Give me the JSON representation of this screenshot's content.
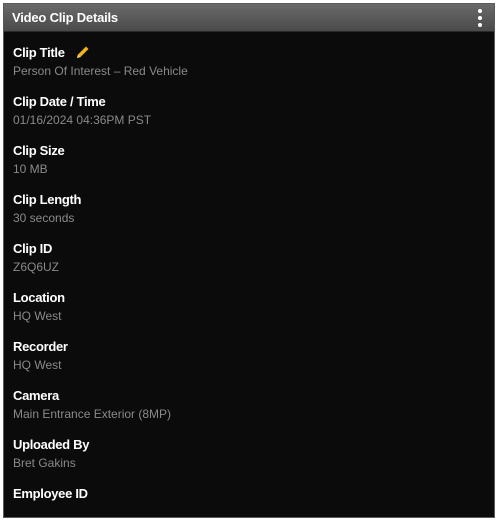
{
  "panel": {
    "title": "Video Clip Details",
    "accent_color": "#f2b21b"
  },
  "fields": [
    {
      "label": "Clip Title",
      "value": "Person Of Interest – Red Vehicle"
    },
    {
      "label": "Clip Date / Time",
      "value": "01/16/2024 04:36PM PST"
    },
    {
      "label": "Clip Size",
      "value": "10 MB"
    },
    {
      "label": "Clip Length",
      "value": "30 seconds"
    },
    {
      "label": "Clip ID",
      "value": "Z6Q6UZ"
    },
    {
      "label": "Location",
      "value": "HQ West"
    },
    {
      "label": "Recorder",
      "value": "HQ West"
    },
    {
      "label": "Camera",
      "value": "Main Entrance Exterior (8MP)"
    },
    {
      "label": "Uploaded By",
      "value": "Bret Gakins"
    },
    {
      "label": "Employee ID",
      "value": ""
    }
  ],
  "icons": {
    "menu": "kebab-menu-icon",
    "edit": "pencil-icon"
  }
}
